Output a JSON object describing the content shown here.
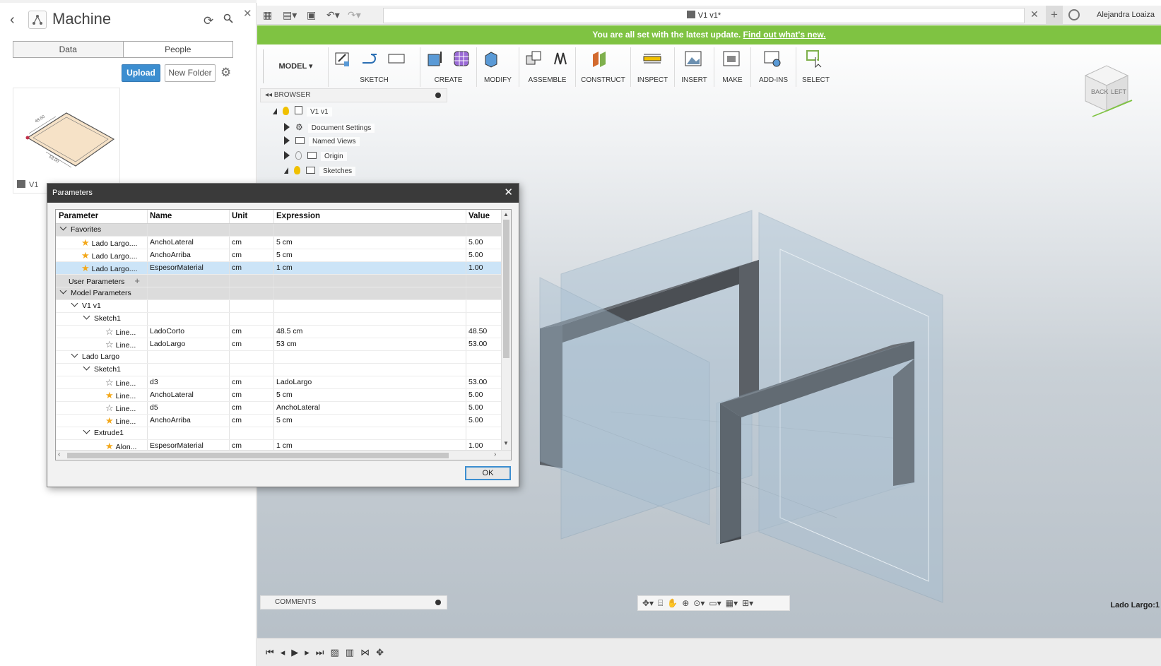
{
  "data_panel": {
    "title": "Machine",
    "tabs": [
      "Data",
      "People"
    ],
    "upload_label": "Upload",
    "new_folder_label": "New Folder",
    "thumbnail": {
      "name": "V1",
      "dimension_1": "48.50",
      "dimension_2": "53.00"
    }
  },
  "app_bar": {
    "document_tab": "V1 v1*",
    "user_name": "Alejandra Loaiza"
  },
  "banner": {
    "message": "You are all set with the latest update.",
    "link": "Find out what's new."
  },
  "toolbar": {
    "workspace": "MODEL",
    "groups": [
      "SKETCH",
      "CREATE",
      "MODIFY",
      "ASSEMBLE",
      "CONSTRUCT",
      "INSPECT",
      "INSERT",
      "MAKE",
      "ADD-INS",
      "SELECT"
    ]
  },
  "browser": {
    "header": "BROWSER",
    "items": [
      {
        "label": "V1 v1"
      },
      {
        "label": "Document Settings"
      },
      {
        "label": "Named Views"
      },
      {
        "label": "Origin"
      },
      {
        "label": "Sketches"
      }
    ]
  },
  "comments_label": "COMMENTS",
  "selection_status": "Lado Largo:1",
  "viewcube": {
    "back": "BACK",
    "left": "LEFT"
  },
  "dialog": {
    "title": "Parameters",
    "columns": [
      "Parameter",
      "Name",
      "Unit",
      "Expression",
      "Value"
    ],
    "groups": {
      "favorites": "Favorites",
      "user_parameters": "User Parameters",
      "model_parameters": "Model Parameters",
      "v1": "V1 v1",
      "sketch1a": "Sketch1",
      "lado_largo": "Lado Largo",
      "sketch1b": "Sketch1",
      "extrude1": "Extrude1"
    },
    "favorites": [
      {
        "param": "Lado Largo....",
        "name": "AnchoLateral",
        "unit": "cm",
        "expression": "5 cm",
        "value": "5.00"
      },
      {
        "param": "Lado Largo....",
        "name": "AnchoArriba",
        "unit": "cm",
        "expression": "5 cm",
        "value": "5.00"
      },
      {
        "param": "Lado Largo....",
        "name": "EspesorMaterial",
        "unit": "cm",
        "expression": "1 cm",
        "value": "1.00"
      }
    ],
    "v1_sketch1": [
      {
        "param": "Line...",
        "name": "LadoCorto",
        "unit": "cm",
        "expression": "48.5 cm",
        "value": "48.50"
      },
      {
        "param": "Line...",
        "name": "LadoLargo",
        "unit": "cm",
        "expression": "53 cm",
        "value": "53.00"
      }
    ],
    "lado_largo_sketch1": [
      {
        "param": "Line...",
        "name": "d3",
        "unit": "cm",
        "expression": "LadoLargo",
        "value": "53.00"
      },
      {
        "param": "Line...",
        "name": "AnchoLateral",
        "unit": "cm",
        "expression": "5 cm",
        "value": "5.00"
      },
      {
        "param": "Line...",
        "name": "d5",
        "unit": "cm",
        "expression": "AnchoLateral",
        "value": "5.00"
      },
      {
        "param": "Line...",
        "name": "AnchoArriba",
        "unit": "cm",
        "expression": "5 cm",
        "value": "5.00"
      }
    ],
    "extrude1": [
      {
        "param": "Alon...",
        "name": "EspesorMaterial",
        "unit": "cm",
        "expression": "1 cm",
        "value": "1.00"
      }
    ],
    "ok_label": "OK"
  }
}
